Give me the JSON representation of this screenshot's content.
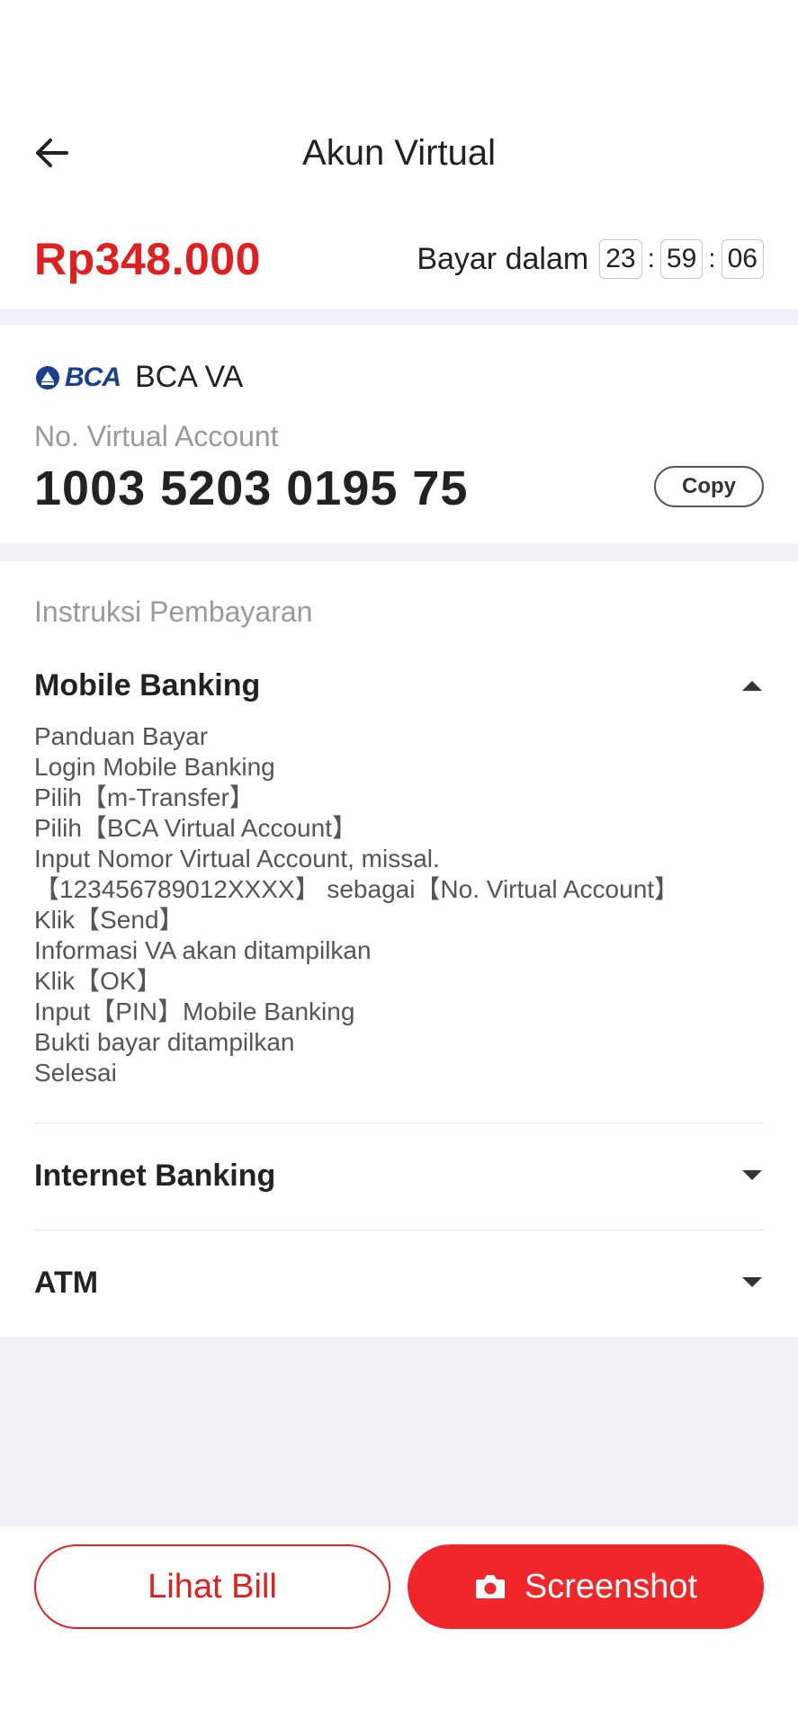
{
  "header": {
    "title": "Akun Virtual"
  },
  "payment": {
    "amount": "Rp348.000",
    "pay_in_label": "Bayar dalam",
    "countdown": {
      "hours": "23",
      "minutes": "59",
      "seconds": "06",
      "separator": ":"
    }
  },
  "va": {
    "bank_name": "BCA VA",
    "logo_text": "BCA",
    "number_label": "No. Virtual Account",
    "number": "1003 5203 0195 75",
    "copy_label": "Copy"
  },
  "instructions": {
    "title": "Instruksi Pembayaran",
    "sections": [
      {
        "label": "Mobile Banking",
        "expanded": true,
        "steps": [
          "Panduan Bayar",
          "Login Mobile Banking",
          "Pilih【m-Transfer】",
          "Pilih【BCA Virtual Account】",
          "Input Nomor Virtual Account, missal.",
          "【123456789012XXXX】 sebagai【No. Virtual Account】",
          "Klik【Send】",
          "Informasi VA akan ditampilkan",
          "Klik【OK】",
          "Input【PIN】Mobile Banking",
          "Bukti bayar ditampilkan",
          "Selesai"
        ]
      },
      {
        "label": "Internet Banking",
        "expanded": false
      },
      {
        "label": "ATM",
        "expanded": false
      }
    ]
  },
  "actions": {
    "view_bill_label": "Lihat Bill",
    "screenshot_label": "Screenshot"
  },
  "colors": {
    "accent": "#e02020",
    "button_solid": "#f0262a",
    "page_gap": "#eef1f5",
    "bca_blue": "#1a3f8f"
  }
}
